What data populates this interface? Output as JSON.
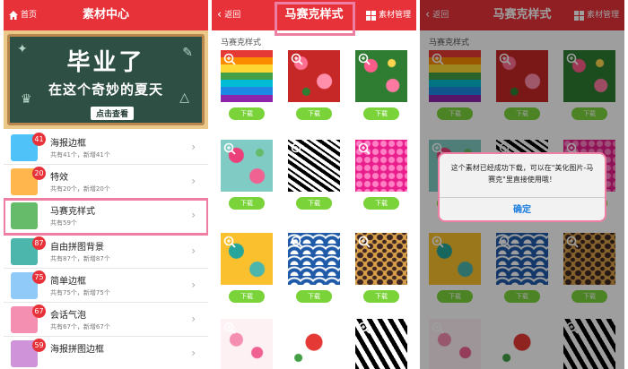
{
  "screen1": {
    "back_label": "首页",
    "title": "素材中心",
    "banner": {
      "line1": "毕业了",
      "line2": "在这个奇妙的夏天",
      "cta": "点击查看"
    },
    "items": [
      {
        "name": "海报边框",
        "sub": "共有41个，新增41个",
        "badge": "41",
        "color": "#4fc3f7"
      },
      {
        "name": "特效",
        "sub": "共有20个，新增20个",
        "badge": "20",
        "color": "#ffb74d"
      },
      {
        "name": "马赛克样式",
        "sub": "共有59个",
        "badge": "",
        "color": "#66bb6a"
      },
      {
        "name": "自由拼图背景",
        "sub": "共有87个，新增87个",
        "badge": "87",
        "color": "#4db6ac"
      },
      {
        "name": "简单边框",
        "sub": "共有75个，新增75个",
        "badge": "75",
        "color": "#90caf9"
      },
      {
        "name": "会话气泡",
        "sub": "共有67个，新增67个",
        "badge": "67",
        "color": "#f48fb1"
      },
      {
        "name": "海报拼图边框",
        "sub": "",
        "badge": "59",
        "color": "#ce93d8"
      }
    ]
  },
  "screen2": {
    "back_label": "返回",
    "title": "马赛克样式",
    "right_label": "素材管理",
    "section": "马赛克样式",
    "download_label": "下载"
  },
  "screen3": {
    "back_label": "返回",
    "title": "马赛克样式",
    "right_label": "素材管理",
    "section": "马赛克样式",
    "download_label": "下载",
    "dialog": {
      "message": "这个素材已经成功下载，可以在\"美化图片-马赛克\"里直接使用哦！",
      "ok": "确定"
    }
  },
  "colors": {
    "header": "#e8323a",
    "download": "#7bd33a",
    "highlight": "#ee7fa3",
    "link": "#1a7de0"
  }
}
